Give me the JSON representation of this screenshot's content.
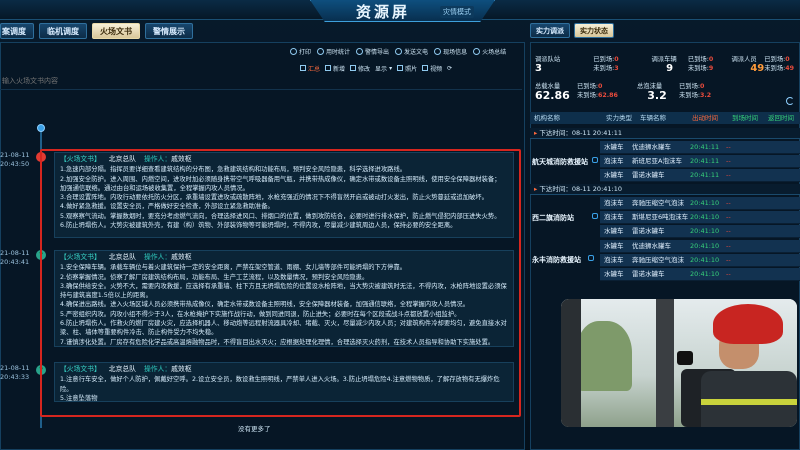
{
  "header": {
    "title": "资源屏",
    "mode": "灾情模式"
  },
  "left_tabs": [
    {
      "label": "案调度"
    },
    {
      "label": "临机调度"
    },
    {
      "label": "火场文书"
    },
    {
      "label": "警情展示"
    }
  ],
  "toolbar_top": [
    {
      "label": "打印"
    },
    {
      "label": "用时统计"
    },
    {
      "label": "警情导出"
    },
    {
      "label": "发送文电"
    },
    {
      "label": "现场信息"
    },
    {
      "label": "火场总结"
    }
  ],
  "toolbar_second": [
    {
      "label": "汇总"
    },
    {
      "label": "新增"
    },
    {
      "label": "修改"
    },
    {
      "label": "显示"
    },
    {
      "label": "照片"
    },
    {
      "label": "视频"
    }
  ],
  "search": {
    "placeholder": "输入火场文书内容"
  },
  "timeline": [
    {
      "date": "21-08-11",
      "time": "20:43:50",
      "dot": "!"
    },
    {
      "date": "21-08-11",
      "time": "20:43:41",
      "dot": "?"
    },
    {
      "date": "21-08-11",
      "time": "20:43:33",
      "dot": "?"
    }
  ],
  "cards": [
    {
      "tag": "【火场文书】",
      "org": "北京总队",
      "op_label": "操作人：",
      "op": "戚效枢",
      "lines": [
        "1.急速内部分隔。指挥员要详细查看建筑结构的分布图，急救建筑结构和功能布局，预判安全风险隐患，科学选择进攻路线。",
        "2.加强安全防护。进入周围、内燃空间，进攻时加必须随身携带空气呼吸器备用气瓶，并携带热成像仪，确定水带或数设备主照明线，使用安全保障器材装备；",
        "加强通信联络。通过由台和运场被收集置，全程掌握内攻人员情况。",
        "3.合理设置阵地。内攻行动要依托防火分区，承重墙设置进攻或疏散阵地，水枪充强近的情况下不得盲然开启或被动打火发出，防止火势蔓延或追加破坏。",
        "4.做好紧急救援。设置安全员，严格做好安全检查，外部设立紧急救助准备。",
        "5.观察察气流动。掌握数烟时，要充分考虑燃气流向，合理选择进风口、排烟口的位置，做到攻防结合，必要时进行排水保护，防止燃气侵犯内部压进失火势。",
        "6.防止坍塌伤人。大势灾被建筑外壳，有建（构）筑物、外部装饰物等可能坍塌时，不得内攻，尽量减少建筑周边人员，保持必要的安全距离。"
      ]
    },
    {
      "tag": "【火场文书】",
      "org": "北京总队",
      "op_label": "操作人：",
      "op": "戚效枢",
      "lines": [
        "1.安全保障车辆。承载车辆位与着火建筑保持一定的安全距离，严禁在架空管道、雨棚、女儿墙等部件可能坍塌的下方停靠。",
        "2.侦察掌握情况。侦察了解厂房建筑结构布局，功能布局、生产工艺流程，以及数量情况，预判安全风险隐患。",
        "3.确保供给安全。火势不大，需要内攻救援，应选择有承重墙、柱下方且无坍塌危险的位置设水枪阵地，当大势灾被建筑时无法，不得内攻，水枪阵地设置必须保",
        "持与建筑高度1.5倍以上的距离。",
        "4.确保进出路线。进入火场区域人员必须携带热成像仪，确定水带或数设备主照明线，安全保障器材装备，加强通信联络，全程掌握内攻人员情况。",
        "5.严密组织内攻。内攻小组不得少于3人，在水枪掩护下实施作战行动，做到同进同退，防止进失；必要时在每个区段或战斗点都放置小组监护。",
        "6.防止坍塌伤人。作救火的燃厂房建火灾，应选择机器人、移动炮等远程射流器具冷却、堵截、灭火，尽量减少内攻人员；对建筑构件冷却要均匀，避免直接水对",
        "梁、柱、墙体等重要构件冷击、防止构件受力不均失稳。",
        "7.谨慎涉化处置。厂房存有危险化学品或高温熔融物品时，不得盲目出水灭火；应根据处理化理情，合理选择灭火药剂，在技术人员指导和协助下实施处置。"
      ]
    },
    {
      "tag": "【火场文书】",
      "org": "北京总队",
      "op_label": "操作人：",
      "op": "戚效枢",
      "lines": [
        "1.注意行车安全，做好个人防护，佩戴好空呼。2.设立安全员，数设救生照明线，严禁单人进入火场。3.防止坍塌危险4.注意燃物物质，了解存放物有无爆炸危险。",
        "5.注意坠落物"
      ]
    }
  ],
  "footer": {
    "no_more": "没有更多了"
  },
  "right_tabs": [
    {
      "label": "实力调派"
    },
    {
      "label": "实力状态"
    }
  ],
  "stats": {
    "row1": [
      {
        "label": "调派队站",
        "value": "3",
        "sub_label": "已到场:",
        "sub_value": "0",
        "sub2_label": "未到场:",
        "sub2_value": "3"
      },
      {
        "label": "调派车辆",
        "value": "9",
        "sub_label": "已到场:",
        "sub_value": "0",
        "sub2_label": "未到场:",
        "sub2_value": "9"
      },
      {
        "label": "调派人员",
        "value": "49",
        "sub_label": "已到场:",
        "sub_value": "0",
        "sub2_label": "未到场:",
        "sub2_value": "49"
      }
    ],
    "row2": [
      {
        "label": "总载水量",
        "value": "62.86",
        "sub_label": "已到场:",
        "sub_value": "0",
        "sub2_label": "未到场:",
        "sub2_value": "62.86"
      },
      {
        "label": "总泡沫量",
        "value": "3.2",
        "sub_label": "已到场:",
        "sub_value": "0",
        "sub2_label": "未到场:",
        "sub2_value": "3.2"
      }
    ]
  },
  "table": {
    "headers": [
      "机构名称",
      "实力类型",
      "车辆名称",
      "出动时间",
      "到场时间",
      "返回时间"
    ]
  },
  "groups": [
    {
      "head": "下达时间：08-11 20:41:11",
      "unit": "航天城消防救援站",
      "rows": [
        [
          "水罐车",
          "优迪狮水罐车",
          "20:41:11",
          "--"
        ],
        [
          "泡沫车",
          "新班尼亚A泡沫车",
          "20:41:11",
          "--"
        ],
        [
          "水罐车",
          "雷诺水罐车",
          "20:41:11",
          "--"
        ]
      ]
    },
    {
      "head": "下达时间：08-11 20:41:10",
      "unit": "西二旗消防站",
      "rows": [
        [
          "泡沫车",
          "奔驰压缩空气泡沫车",
          "20:41:10",
          "--"
        ],
        [
          "泡沫车",
          "斯堪尼亚6吨泡沫车",
          "20:41:10",
          "--"
        ],
        [
          "水罐车",
          "雷诺水罐车",
          "20:41:10",
          "--"
        ]
      ]
    },
    {
      "head": "",
      "unit": "永丰消防救援站",
      "rows": [
        [
          "水罐车",
          "优迪狮水罐车",
          "20:41:10",
          "--"
        ],
        [
          "泡沫车",
          "奔驰压缩空气泡沫车",
          "20:41:10",
          "--"
        ],
        [
          "水罐车",
          "雷诺水罐车",
          "20:41:10",
          "--"
        ]
      ]
    }
  ],
  "colors": {
    "accent": "#3aa0e6",
    "alert": "#d6261f",
    "warn": "#ff9b3a",
    "ok": "#37d37a"
  }
}
